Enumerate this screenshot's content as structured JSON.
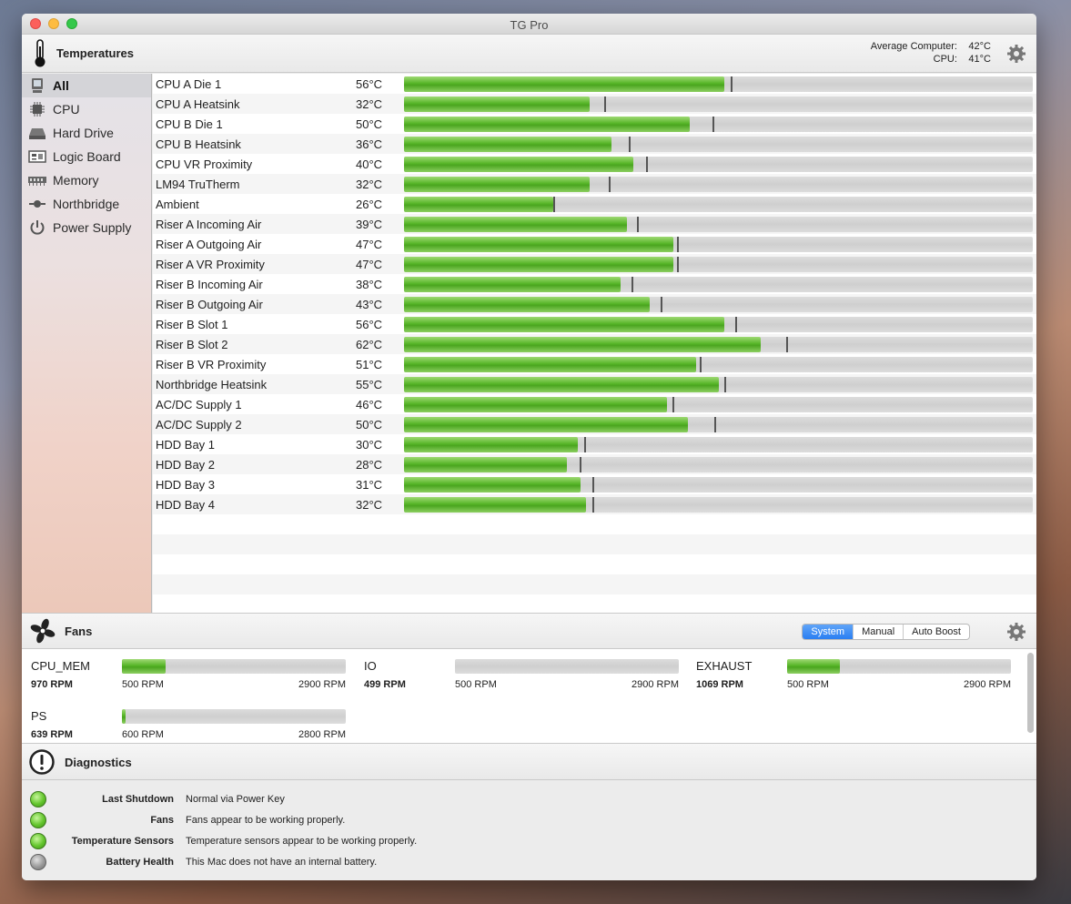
{
  "window": {
    "title": "TG Pro"
  },
  "temperatures": {
    "title": "Temperatures",
    "average_label": "Average Computer:",
    "average_value": "42°C",
    "cpu_label": "CPU:",
    "cpu_value": "41°C"
  },
  "sidebar": {
    "items": [
      {
        "label": "All",
        "icon": "computer-icon",
        "selected": true
      },
      {
        "label": "CPU",
        "icon": "cpu-chip-icon"
      },
      {
        "label": "Hard Drive",
        "icon": "hard-drive-icon"
      },
      {
        "label": "Logic Board",
        "icon": "logic-board-icon"
      },
      {
        "label": "Memory",
        "icon": "memory-icon"
      },
      {
        "label": "Northbridge",
        "icon": "northbridge-icon"
      },
      {
        "label": "Power Supply",
        "icon": "power-icon"
      }
    ]
  },
  "sensors": [
    {
      "name": "CPU A Die 1",
      "value": "56°C",
      "fill": 0.51,
      "max": 0.52
    },
    {
      "name": "CPU A Heatsink",
      "value": "32°C",
      "fill": 0.295,
      "max": 0.318
    },
    {
      "name": "CPU B Die 1",
      "value": "50°C",
      "fill": 0.455,
      "max": 0.491
    },
    {
      "name": "CPU B Heatsink",
      "value": "36°C",
      "fill": 0.33,
      "max": 0.357
    },
    {
      "name": "CPU VR Proximity",
      "value": "40°C",
      "fill": 0.365,
      "max": 0.385
    },
    {
      "name": "LM94 TruTherm",
      "value": "32°C",
      "fill": 0.295,
      "max": 0.326
    },
    {
      "name": "Ambient",
      "value": "26°C",
      "fill": 0.237,
      "max": 0.238
    },
    {
      "name": "Riser A Incoming Air",
      "value": "39°C",
      "fill": 0.355,
      "max": 0.37
    },
    {
      "name": "Riser A Outgoing Air",
      "value": "47°C",
      "fill": 0.428,
      "max": 0.434
    },
    {
      "name": "Riser A VR Proximity",
      "value": "47°C",
      "fill": 0.428,
      "max": 0.434
    },
    {
      "name": "Riser B Incoming Air",
      "value": "38°C",
      "fill": 0.345,
      "max": 0.362
    },
    {
      "name": "Riser B Outgoing Air",
      "value": "43°C",
      "fill": 0.391,
      "max": 0.408
    },
    {
      "name": "Riser B Slot 1",
      "value": "56°C",
      "fill": 0.51,
      "max": 0.527
    },
    {
      "name": "Riser B Slot 2",
      "value": "62°C",
      "fill": 0.568,
      "max": 0.608
    },
    {
      "name": "Riser B VR Proximity",
      "value": "51°C",
      "fill": 0.464,
      "max": 0.471
    },
    {
      "name": "Northbridge Heatsink",
      "value": "55°C",
      "fill": 0.5,
      "max": 0.509
    },
    {
      "name": "AC/DC Supply 1",
      "value": "46°C",
      "fill": 0.418,
      "max": 0.427
    },
    {
      "name": "AC/DC Supply 2",
      "value": "50°C",
      "fill": 0.452,
      "max": 0.493
    },
    {
      "name": "HDD Bay 1",
      "value": "30°C",
      "fill": 0.276,
      "max": 0.286
    },
    {
      "name": "HDD Bay 2",
      "value": "28°C",
      "fill": 0.259,
      "max": 0.28
    },
    {
      "name": "HDD Bay 3",
      "value": "31°C",
      "fill": 0.281,
      "max": 0.299
    },
    {
      "name": "HDD Bay 4",
      "value": "32°C",
      "fill": 0.29,
      "max": 0.299
    }
  ],
  "fans": {
    "title": "Fans",
    "modes": [
      "System",
      "Manual",
      "Auto Boost"
    ],
    "selected_mode": "System",
    "items": [
      {
        "name": "CPU_MEM",
        "rpm": "970 RPM",
        "min": "500 RPM",
        "max": "2900 RPM",
        "fill": 0.196
      },
      {
        "name": "IO",
        "rpm": "499 RPM",
        "min": "500 RPM",
        "max": "2900 RPM",
        "fill": 0.0
      },
      {
        "name": "EXHAUST",
        "rpm": "1069 RPM",
        "min": "500 RPM",
        "max": "2900 RPM",
        "fill": 0.237
      },
      {
        "name": "PS",
        "rpm": "639 RPM",
        "min": "600 RPM",
        "max": "2800 RPM",
        "fill": 0.018
      }
    ]
  },
  "diagnostics": {
    "title": "Diagnostics",
    "items": [
      {
        "label": "Last Shutdown",
        "text": "Normal via Power Key",
        "status": "green"
      },
      {
        "label": "Fans",
        "text": "Fans appear to be working properly.",
        "status": "green"
      },
      {
        "label": "Temperature Sensors",
        "text": "Temperature sensors appear to be working properly.",
        "status": "green"
      },
      {
        "label": "Battery Health",
        "text": "This Mac does not have an internal battery.",
        "status": "gray"
      }
    ]
  }
}
